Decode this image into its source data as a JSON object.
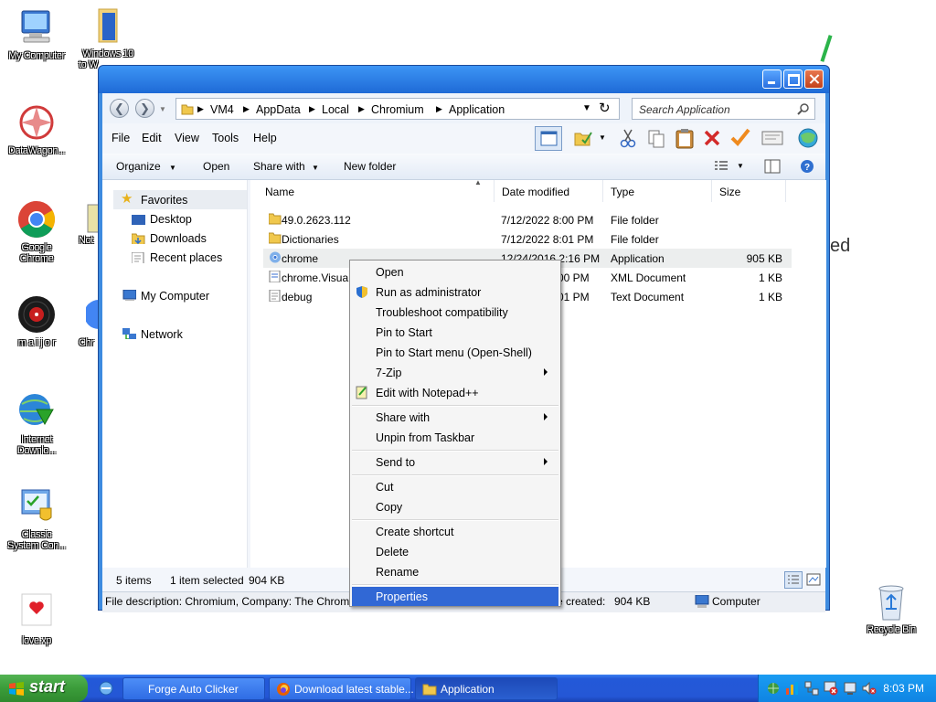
{
  "desktop": {
    "icons": [
      {
        "label": "My Computer"
      },
      {
        "label": "Windows 10"
      },
      {
        "label": "to W"
      },
      {
        "label": "DataWagon..."
      },
      {
        "label": "Google"
      },
      {
        "label": "Chrome"
      },
      {
        "label": "Not"
      },
      {
        "label": "m a i j o r"
      },
      {
        "label": "Chr"
      },
      {
        "label": "Internet"
      },
      {
        "label": "Downlo..."
      },
      {
        "label": "Classic"
      },
      {
        "label": "System Con..."
      },
      {
        "label": "love.xp"
      },
      {
        "label": "Recycle Bin"
      }
    ],
    "bg_text": "ed"
  },
  "window": {
    "breadcrumb": [
      "VM4",
      "AppData",
      "Local",
      "Chromium",
      "Application"
    ],
    "search_placeholder": "Search Application",
    "menu": [
      "File",
      "Edit",
      "View",
      "Tools",
      "Help"
    ],
    "commands": [
      "Organize",
      "Open",
      "Share with",
      "New folder"
    ],
    "nav": {
      "favorites": "Favorites",
      "desktop": "Desktop",
      "downloads": "Downloads",
      "recent": "Recent places",
      "computer": "My Computer",
      "network": "Network"
    },
    "columns": [
      "Name",
      "Date modified",
      "Type",
      "Size"
    ],
    "files": [
      {
        "name": "49.0.2623.112",
        "date": "7/12/2022 8:00 PM",
        "type": "File folder",
        "size": ""
      },
      {
        "name": "Dictionaries",
        "date": "7/12/2022 8:01 PM",
        "type": "File folder",
        "size": ""
      },
      {
        "name": "chrome",
        "date": "12/24/2016 2:16 PM",
        "type": "Application",
        "size": "905 KB"
      },
      {
        "name": "chrome.Visua",
        "date": "00 PM",
        "type": "XML Document",
        "size": "1 KB"
      },
      {
        "name": "debug",
        "date": "01 PM",
        "type": "Text Document",
        "size": "1 KB"
      }
    ],
    "status": {
      "items": "5 items",
      "selected": "1 item selected",
      "selsize": "904 KB"
    },
    "statusbar": {
      "desc": "File description: Chromium, Company: The Chrom",
      "created": "e created:",
      "size": "904 KB",
      "zone": "Computer"
    }
  },
  "context_menu": {
    "items": [
      "Open",
      "Run as administrator",
      "Troubleshoot compatibility",
      "Pin to Start",
      "Pin to Start menu (Open-Shell)",
      "7-Zip",
      "Edit with Notepad++",
      "Share with",
      "Unpin from Taskbar",
      "Send to",
      "Cut",
      "Copy",
      "Create shortcut",
      "Delete",
      "Rename",
      "Properties"
    ]
  },
  "taskbar": {
    "start": "start",
    "buttons": [
      "Forge Auto Clicker",
      "Download latest stable...",
      "Application"
    ],
    "clock": "8:03 PM"
  },
  "colors": {
    "accent": "#3168d5",
    "taskbar": "#2457d6",
    "start": "#3b9c3a",
    "titlebar": "#1e6ad6"
  }
}
